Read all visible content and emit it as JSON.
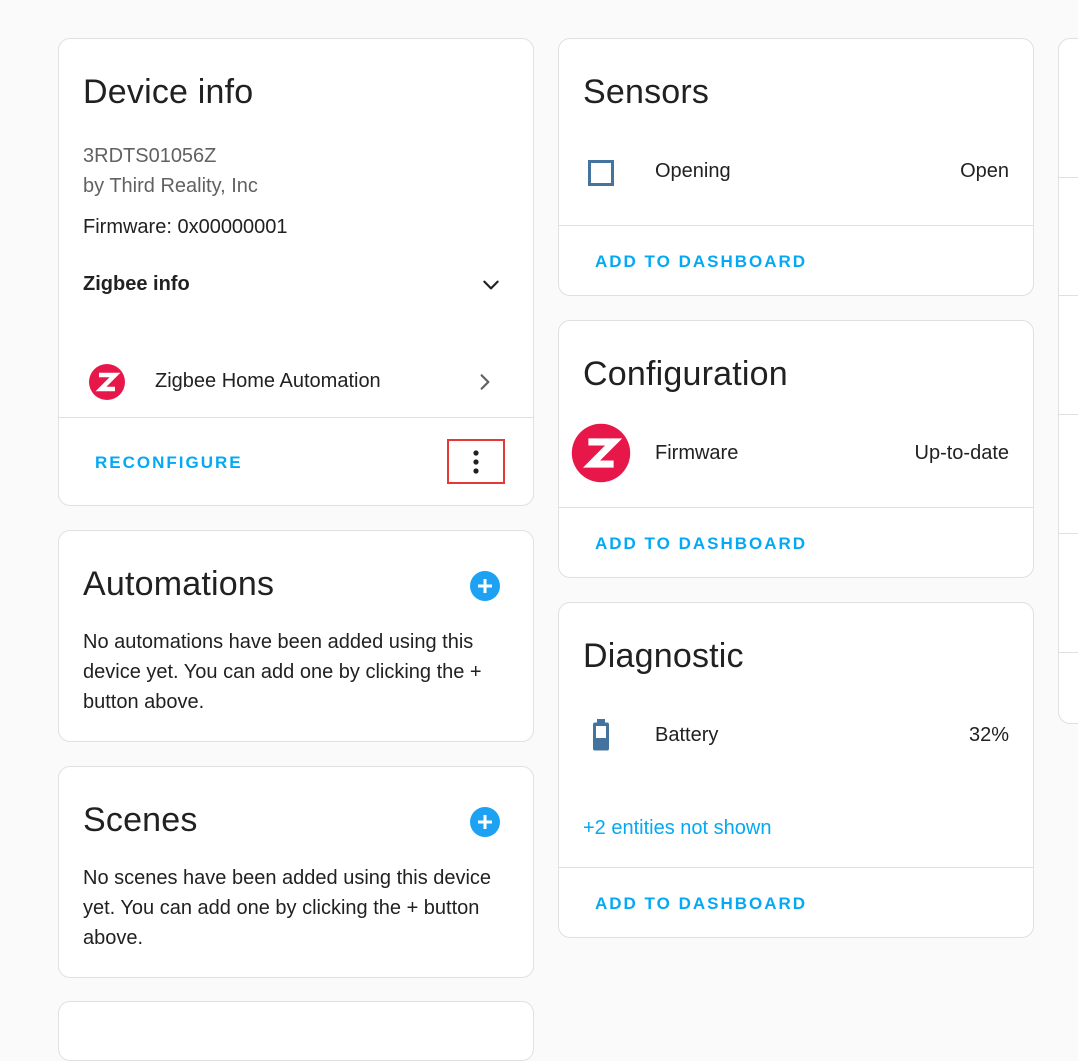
{
  "device_info": {
    "title": "Device info",
    "model": "3RDTS01056Z",
    "manufacturer": "by Third Reality, Inc",
    "firmware": "Firmware: 0x00000001",
    "zigbee_info_label": "Zigbee info",
    "integration_name": "Zigbee Home Automation",
    "integration_logo_letter": "Z",
    "reconfigure_label": "RECONFIGURE",
    "more_icon": "more-vert-icon"
  },
  "automations": {
    "title": "Automations",
    "empty_text": "No automations have been added using this device yet. You can add one by clicking the + button above."
  },
  "scenes": {
    "title": "Scenes",
    "empty_text": "No scenes have been added using this device yet. You can add one by clicking the + button above."
  },
  "sensors": {
    "title": "Sensors",
    "items": [
      {
        "icon": "checkbox-blank-outline-icon",
        "label": "Opening",
        "value": "Open"
      }
    ],
    "action_label": "ADD TO DASHBOARD"
  },
  "configuration": {
    "title": "Configuration",
    "items": [
      {
        "icon": "zigbee-logo-icon",
        "label": "Firmware",
        "value": "Up-to-date"
      }
    ],
    "action_label": "ADD TO DASHBOARD"
  },
  "diagnostic": {
    "title": "Diagnostic",
    "items": [
      {
        "icon": "battery-icon",
        "label": "Battery",
        "value": "32%"
      }
    ],
    "hidden_entities_link": "+2 entities not shown",
    "action_label": "ADD TO DASHBOARD"
  },
  "colors": {
    "accent": "#03a9f4",
    "zigbee_red": "#e8174a",
    "icon_blue": "#44739e",
    "highlight_red": "#e53935"
  }
}
